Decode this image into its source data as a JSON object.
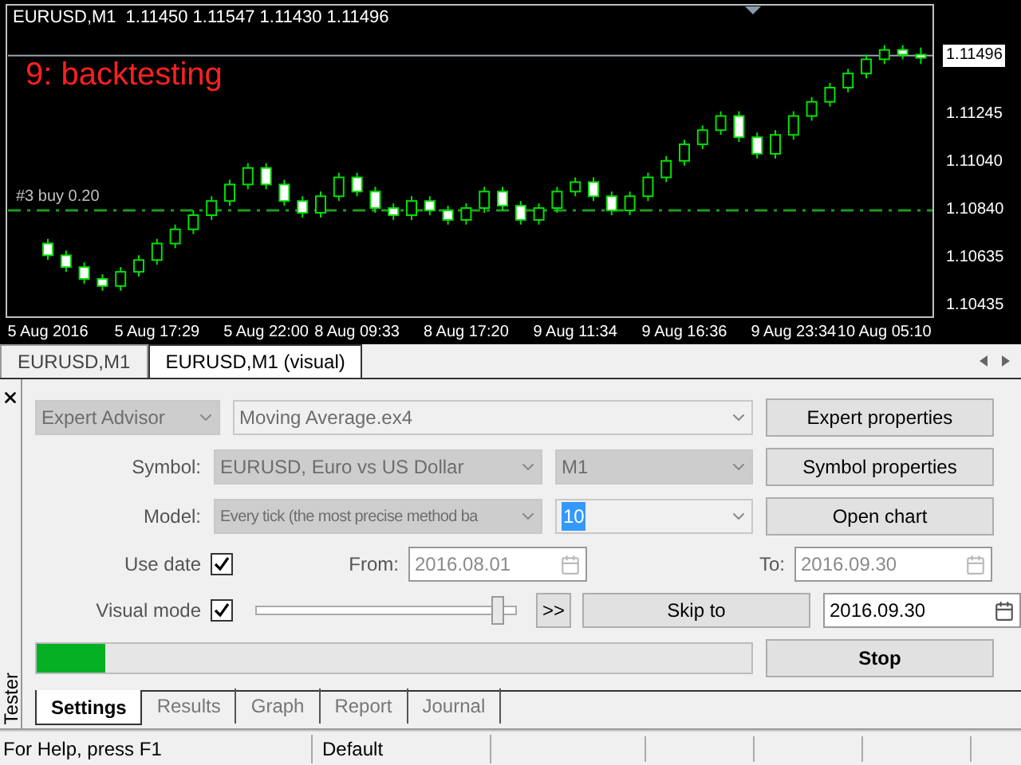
{
  "chart": {
    "symbol": "EURUSD,M1",
    "ohlc": "1.11450 1.11547 1.11430 1.11496",
    "overlay_text": "9: backtesting",
    "chart_data": {
      "type": "candlestick",
      "ylim": [
        1.10388,
        1.11711
      ],
      "ref_lines": [
        {
          "axis": "y",
          "value": 1.11496,
          "label": "1.11496"
        },
        {
          "axis": "y",
          "value": 1.1084,
          "label": "#3 buy 0.20"
        }
      ],
      "yticks": [
        {
          "value": 1.11245,
          "label": "1.11245"
        },
        {
          "value": 1.1104,
          "label": "1.11040"
        },
        {
          "value": 1.1084,
          "label": "1.10840"
        },
        {
          "value": 1.10635,
          "label": "1.10635"
        },
        {
          "value": 1.10435,
          "label": "1.10435"
        }
      ],
      "categories": [
        "5 Aug 2016",
        null,
        null,
        null,
        null,
        null,
        "5 Aug 17:29",
        null,
        null,
        null,
        null,
        null,
        "5 Aug 22:00",
        null,
        null,
        null,
        null,
        "8 Aug 09:33",
        null,
        null,
        null,
        null,
        null,
        "8 Aug 17:20",
        null,
        null,
        null,
        null,
        null,
        "9 Aug 11:34",
        null,
        null,
        null,
        null,
        null,
        "9 Aug 16:36",
        null,
        null,
        null,
        null,
        null,
        "9 Aug 23:34",
        null,
        null,
        null,
        null,
        "10 Aug 05:10",
        null,
        null
      ],
      "ohlc": [
        [
          1.107,
          1.1072,
          1.1063,
          1.1065
        ],
        [
          1.1065,
          1.1067,
          1.1058,
          1.106
        ],
        [
          1.106,
          1.1062,
          1.1053,
          1.1055
        ],
        [
          1.1055,
          1.1057,
          1.105,
          1.1052
        ],
        [
          1.1052,
          1.106,
          1.105,
          1.1058
        ],
        [
          1.1058,
          1.1065,
          1.1056,
          1.1063
        ],
        [
          1.1063,
          1.1072,
          1.1061,
          1.107
        ],
        [
          1.107,
          1.1078,
          1.1068,
          1.1076
        ],
        [
          1.1076,
          1.1084,
          1.1074,
          1.1082
        ],
        [
          1.1082,
          1.109,
          1.108,
          1.1088
        ],
        [
          1.1088,
          1.1097,
          1.1086,
          1.1095
        ],
        [
          1.1095,
          1.1104,
          1.1093,
          1.1102
        ],
        [
          1.1102,
          1.1104,
          1.1093,
          1.1095
        ],
        [
          1.1095,
          1.1097,
          1.1086,
          1.1088
        ],
        [
          1.1088,
          1.109,
          1.1081,
          1.1083
        ],
        [
          1.1083,
          1.1092,
          1.1081,
          1.109
        ],
        [
          1.109,
          1.11,
          1.1088,
          1.1098
        ],
        [
          1.1098,
          1.11,
          1.109,
          1.1092
        ],
        [
          1.1092,
          1.1094,
          1.1083,
          1.1085
        ],
        [
          1.1085,
          1.1087,
          1.108,
          1.1082
        ],
        [
          1.1082,
          1.109,
          1.108,
          1.1088
        ],
        [
          1.1088,
          1.109,
          1.1082,
          1.1084
        ],
        [
          1.1084,
          1.1086,
          1.1078,
          1.108
        ],
        [
          1.108,
          1.1087,
          1.1078,
          1.1085
        ],
        [
          1.1085,
          1.1094,
          1.1083,
          1.1092
        ],
        [
          1.1092,
          1.1094,
          1.1084,
          1.1086
        ],
        [
          1.1086,
          1.1088,
          1.1078,
          1.108
        ],
        [
          1.108,
          1.1087,
          1.1078,
          1.1085
        ],
        [
          1.1085,
          1.1094,
          1.1083,
          1.1092
        ],
        [
          1.1092,
          1.1098,
          1.109,
          1.1096
        ],
        [
          1.1096,
          1.1098,
          1.1088,
          1.109
        ],
        [
          1.109,
          1.1092,
          1.1082,
          1.1084
        ],
        [
          1.1084,
          1.1092,
          1.1082,
          1.109
        ],
        [
          1.109,
          1.11,
          1.1088,
          1.1098
        ],
        [
          1.1098,
          1.1107,
          1.1096,
          1.1105
        ],
        [
          1.1105,
          1.1114,
          1.1103,
          1.1112
        ],
        [
          1.1112,
          1.112,
          1.111,
          1.1118
        ],
        [
          1.1118,
          1.1126,
          1.1116,
          1.1124
        ],
        [
          1.1124,
          1.1126,
          1.1113,
          1.1115
        ],
        [
          1.1115,
          1.1117,
          1.1106,
          1.1108
        ],
        [
          1.1108,
          1.1118,
          1.1106,
          1.1116
        ],
        [
          1.1116,
          1.1126,
          1.1114,
          1.1124
        ],
        [
          1.1124,
          1.1132,
          1.1122,
          1.113
        ],
        [
          1.113,
          1.1138,
          1.1128,
          1.1136
        ],
        [
          1.1136,
          1.1144,
          1.1134,
          1.1142
        ],
        [
          1.1142,
          1.115,
          1.114,
          1.1148
        ],
        [
          1.1148,
          1.1154,
          1.1146,
          1.1152
        ],
        [
          1.1152,
          1.1154,
          1.1148,
          1.115
        ],
        [
          1.115,
          1.1153,
          1.1146,
          1.11496
        ]
      ]
    }
  },
  "chart_tabs": [
    {
      "label": "EURUSD,M1",
      "selected": false
    },
    {
      "label": "EURUSD,M1 (visual)",
      "selected": true
    }
  ],
  "tester": {
    "side_label": "Tester",
    "expert_type": {
      "value": "Expert Advisor",
      "disabled": true
    },
    "expert": {
      "value": "Moving Average.ex4",
      "disabled": false
    },
    "symbol": {
      "label": "Symbol:",
      "value": "EURUSD, Euro vs US Dollar",
      "disabled": true
    },
    "period": {
      "value": "M1",
      "disabled": true
    },
    "model": {
      "label": "Model:",
      "value": "Every tick (the most precise method ba",
      "disabled": true
    },
    "spread": {
      "value": "10",
      "disabled": false
    },
    "buttons": [
      "Expert properties",
      "Symbol properties",
      "Open chart"
    ],
    "use_date": {
      "label": "Use date",
      "checked": true
    },
    "from": {
      "label": "From:",
      "value": "2016.08.01",
      "disabled": true
    },
    "to": {
      "label": "To:",
      "value": "2016.09.30",
      "disabled": true
    },
    "visual_mode": {
      "label": "Visual mode",
      "checked": true
    },
    "speed": {
      "level": 0.95
    },
    "fast_button": ">>",
    "skip_button": "Skip to",
    "skip_date": {
      "value": "2016.09.30",
      "disabled": false
    },
    "progress": {
      "level": 0.095
    },
    "stop_button": "Stop",
    "tabs": [
      {
        "label": "Settings",
        "selected": true
      },
      {
        "label": "Results",
        "selected": false
      },
      {
        "label": "Graph",
        "selected": false
      },
      {
        "label": "Report",
        "selected": false
      },
      {
        "label": "Journal",
        "selected": false
      }
    ]
  },
  "status_bar": [
    "For Help, press F1",
    "Default"
  ]
}
